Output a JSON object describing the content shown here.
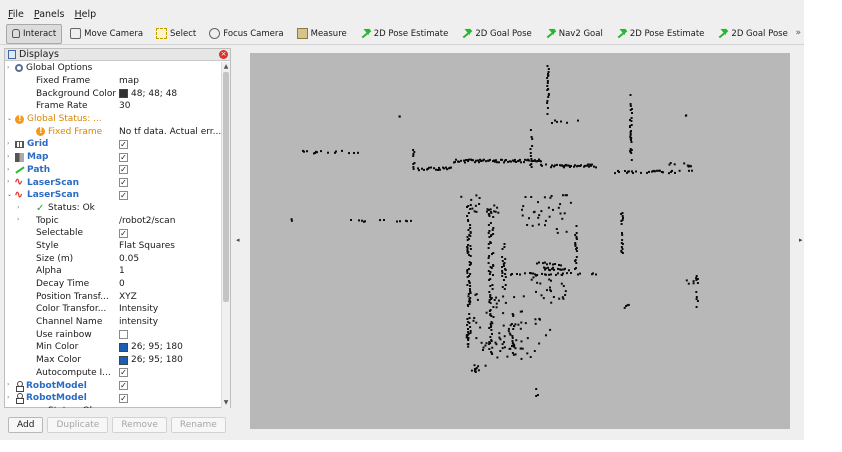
{
  "menubar": {
    "items": [
      "File",
      "Panels",
      "Help"
    ]
  },
  "toolbar": {
    "tools": [
      {
        "label": "Interact",
        "icon": "hand-icon",
        "active": true
      },
      {
        "label": "Move Camera",
        "icon": "camera-icon"
      },
      {
        "label": "Select",
        "icon": "select-icon"
      },
      {
        "label": "Focus Camera",
        "icon": "focus-icon"
      },
      {
        "label": "Measure",
        "icon": "ruler-icon"
      },
      {
        "label": "2D Pose Estimate",
        "icon": "green-arrow-icon"
      },
      {
        "label": "2D Goal Pose",
        "icon": "green-arrow-icon"
      },
      {
        "label": "Nav2 Goal",
        "icon": "green-arrow-icon"
      },
      {
        "label": "2D Pose Estimate",
        "icon": "green-arrow-icon"
      },
      {
        "label": "2D Goal Pose",
        "icon": "green-arrow-icon"
      }
    ],
    "more": "»"
  },
  "displays": {
    "title": "Displays",
    "close_glyph": "×",
    "rows": [
      {
        "indent": 1,
        "icon": "gear-icon",
        "label": "Global Options",
        "value": "",
        "style": "",
        "exp": "›"
      },
      {
        "indent": 2,
        "icon": "",
        "label": "Fixed Frame",
        "value": "map"
      },
      {
        "indent": 2,
        "icon": "",
        "label": "Background Color",
        "value": "48; 48; 48",
        "swatch": "#303030"
      },
      {
        "indent": 2,
        "icon": "",
        "label": "Frame Rate",
        "value": "30"
      },
      {
        "indent": 1,
        "icon": "warning-icon",
        "label": "Global Status: ...",
        "value": "",
        "style": "orange",
        "exp": "⌄"
      },
      {
        "indent": 2,
        "icon": "warning-icon",
        "label": "Fixed Frame",
        "value": "No tf data.  Actual err...",
        "style": "orange"
      },
      {
        "indent": 1,
        "icon": "grid-icon",
        "label": "Grid",
        "value": "✓",
        "check": true,
        "style": "blue-b",
        "exp": "›"
      },
      {
        "indent": 1,
        "icon": "map-icon",
        "label": "Map",
        "value": "✓",
        "check": true,
        "style": "blue-b",
        "exp": "›"
      },
      {
        "indent": 1,
        "icon": "path-icon",
        "label": "Path",
        "value": "✓",
        "check": true,
        "style": "blue-b",
        "exp": "›"
      },
      {
        "indent": 1,
        "icon": "laserscan-icon",
        "label": "LaserScan",
        "value": "✓",
        "check": true,
        "style": "blue-b",
        "exp": "›"
      },
      {
        "indent": 1,
        "icon": "laserscan-icon",
        "label": "LaserScan",
        "value": "✓",
        "check": true,
        "style": "blue-b",
        "exp": "⌄"
      },
      {
        "indent": 2,
        "icon": "ok-icon",
        "label": "Status: Ok",
        "value": "",
        "exp": "›"
      },
      {
        "indent": 2,
        "icon": "",
        "label": "Topic",
        "value": "/robot2/scan",
        "exp": "›"
      },
      {
        "indent": 2,
        "icon": "",
        "label": "Selectable",
        "value": "✓",
        "check": true
      },
      {
        "indent": 2,
        "icon": "",
        "label": "Style",
        "value": "Flat Squares"
      },
      {
        "indent": 2,
        "icon": "",
        "label": "Size (m)",
        "value": "0.05"
      },
      {
        "indent": 2,
        "icon": "",
        "label": "Alpha",
        "value": "1"
      },
      {
        "indent": 2,
        "icon": "",
        "label": "Decay Time",
        "value": "0"
      },
      {
        "indent": 2,
        "icon": "",
        "label": "Position Transf...",
        "value": "XYZ"
      },
      {
        "indent": 2,
        "icon": "",
        "label": "Color Transfor...",
        "value": "Intensity"
      },
      {
        "indent": 2,
        "icon": "",
        "label": "Channel Name",
        "value": "intensity"
      },
      {
        "indent": 2,
        "icon": "",
        "label": "Use rainbow",
        "value": "",
        "check": true
      },
      {
        "indent": 2,
        "icon": "",
        "label": "Min Color",
        "value": "26; 95; 180",
        "swatch": "#1a5fb4"
      },
      {
        "indent": 2,
        "icon": "",
        "label": "Max Color",
        "value": "26; 95; 180",
        "swatch": "#1a5fb4"
      },
      {
        "indent": 2,
        "icon": "",
        "label": "Autocompute I...",
        "value": "✓",
        "check": true
      },
      {
        "indent": 1,
        "icon": "robot-icon",
        "label": "RobotModel",
        "value": "✓",
        "check": true,
        "style": "blue-b",
        "exp": "›"
      },
      {
        "indent": 1,
        "icon": "robot-icon",
        "label": "RobotModel",
        "value": "✓",
        "check": true,
        "style": "blue-b",
        "exp": "›"
      },
      {
        "indent": 2,
        "icon": "ok-icon",
        "label": "Status: Ok",
        "value": "",
        "exp": "›"
      }
    ]
  },
  "buttons": [
    {
      "label": "Add",
      "enabled": true
    },
    {
      "label": "Duplicate",
      "enabled": false
    },
    {
      "label": "Remove",
      "enabled": false
    },
    {
      "label": "Rename",
      "enabled": false
    }
  ],
  "view": {
    "background": "#b8b8b8",
    "point_color": "#0a0a0a",
    "collapse_left": "◂",
    "collapse_right": "▸"
  }
}
